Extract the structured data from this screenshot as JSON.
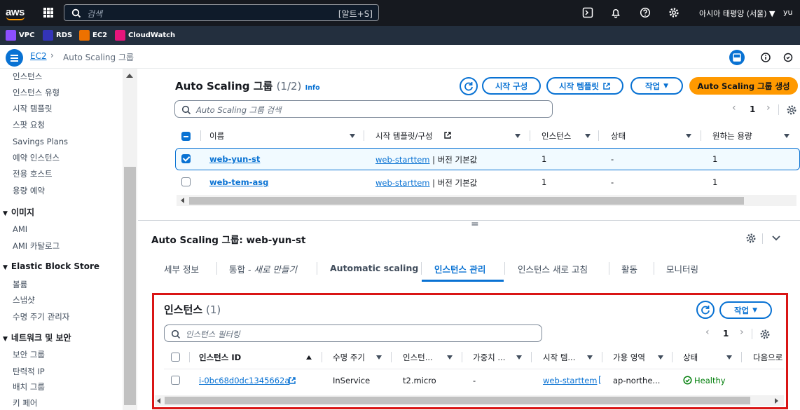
{
  "topbar": {
    "logo_text": "aws",
    "search_placeholder": "검색",
    "search_shortcut": "[알트+S]",
    "region": "아시아 태평양 (서울) ▼",
    "user": "yu"
  },
  "favorites": [
    {
      "label": "VPC",
      "color": "#8c4fff"
    },
    {
      "label": "RDS",
      "color": "#3334b9"
    },
    {
      "label": "EC2",
      "color": "#ed7100"
    },
    {
      "label": "CloudWatch",
      "color": "#e7157b"
    }
  ],
  "breadcrumb": {
    "service": "EC2",
    "separator": "›",
    "current": "Auto Scaling 그룹"
  },
  "sidebar": {
    "items_top": [
      "인스턴스",
      "인스턴스 유형",
      "시작 템플릿",
      "스팟 요청",
      "Savings Plans",
      "예약 인스턴스",
      "전용 호스트",
      "용량 예약"
    ],
    "section_images": "이미지",
    "items_images": [
      "AMI",
      "AMI 카탈로그"
    ],
    "section_ebs": "Elastic Block Store",
    "items_ebs": [
      "볼륨",
      "스냅샷",
      "수명 주기 관리자"
    ],
    "section_network": "네트워크 및 보안",
    "items_network": [
      "보안 그룹",
      "탄력적 IP",
      "배치 그룹",
      "키 페어"
    ]
  },
  "asg_panel": {
    "title": "Auto Scaling 그룹",
    "count": "(1/2)",
    "info": "Info",
    "btn_launch_config": "시작 구성",
    "btn_launch_template": "시작 템플릿",
    "btn_actions": "작업",
    "btn_create": "Auto Scaling 그룹 생성",
    "search_placeholder": "Auto Scaling 그룹 검색",
    "page": "1",
    "columns": [
      "이름",
      "시작 템플릿/구성",
      "인스턴스",
      "상태",
      "원하는 용량"
    ],
    "rows": [
      {
        "name": "web-yun-st",
        "template": "web-starttem",
        "version": " | 버전 기본값",
        "instances": "1",
        "status": "-",
        "desired": "1",
        "selected": true
      },
      {
        "name": "web-tem-asg",
        "template": "web-starttem",
        "version": " | 버전 기본값",
        "instances": "1",
        "status": "-",
        "desired": "1",
        "selected": false
      }
    ]
  },
  "detail": {
    "splitter": "=",
    "title": "Auto Scaling 그룹: web-yun-st",
    "tabs": [
      {
        "label": "세부 정보",
        "active": false
      },
      {
        "label": "통합 - ",
        "italic": "새로 만들기",
        "active": false
      },
      {
        "label": "Automatic scaling",
        "active": false
      },
      {
        "label": "인스턴스 관리",
        "active": true
      },
      {
        "label": "인스턴스 새로 고침",
        "active": false
      },
      {
        "label": "활동",
        "active": false
      },
      {
        "label": "모니터링",
        "active": false
      }
    ]
  },
  "instances_panel": {
    "title": "인스턴스",
    "count": "(1)",
    "btn_actions": "작업",
    "filter_placeholder": "인스턴스 필터링",
    "page": "1",
    "columns": [
      "인스턴스 ID",
      "수명 주기",
      "인스턴...",
      "가중치 ...",
      "시작 템...",
      "가용 영역",
      "상태",
      "다음으로"
    ],
    "rows": [
      {
        "id": "i-0bc68d0dc1345662a",
        "lifecycle": "InService",
        "type": "t2.micro",
        "weight": "-",
        "template": "web-starttem",
        "az": "ap-northe...",
        "health": "Healthy"
      }
    ]
  },
  "colors": {
    "accent": "#0972d3",
    "primary_button": "#ff9900",
    "highlight_border": "#d91515",
    "healthy": "#037f0c"
  }
}
